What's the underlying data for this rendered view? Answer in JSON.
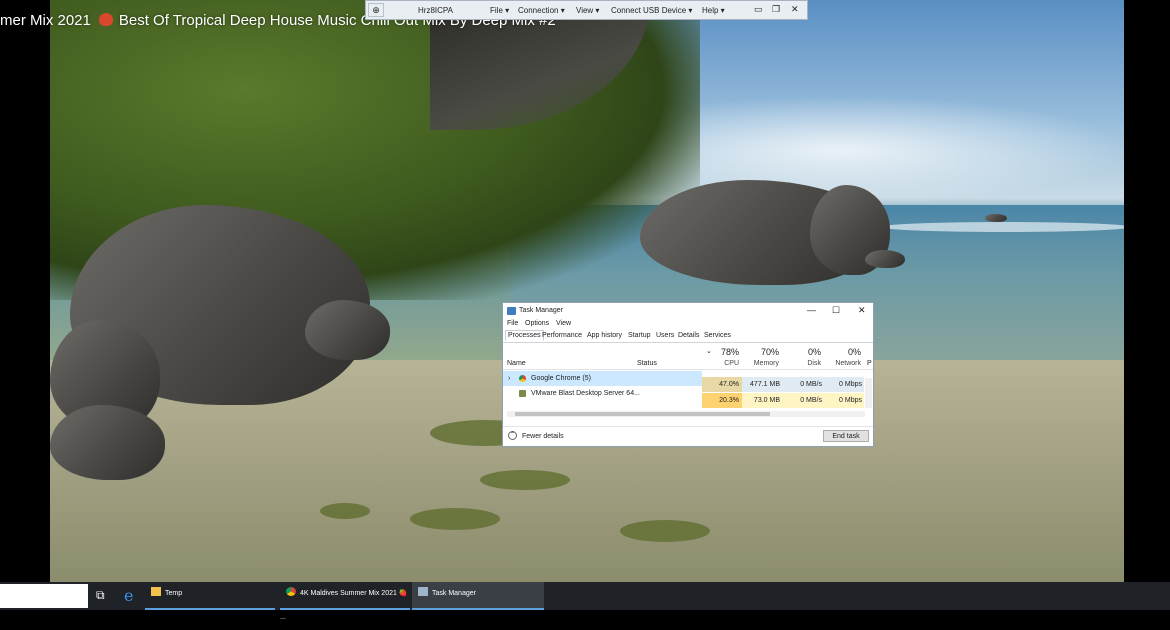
{
  "video": {
    "title": "mer Mix 2021",
    "title_rest": "Best Of Tropical Deep House Music Chill Out Mix By Deep Mix #2",
    "colors": {
      "sky": "#5a8fc4",
      "sea": "#4b86a8",
      "sand": "#b7b496",
      "jungle": "#3e5a1e"
    }
  },
  "vnc_toolbar": {
    "pin_icon": "pin-icon",
    "host": "Hrz8ICPA",
    "menus": [
      "File ▾",
      "Connection ▾",
      "View ▾",
      "Connect USB Device ▾",
      "Help ▾"
    ],
    "controls": [
      "▭",
      "❐",
      "✕"
    ]
  },
  "task_manager": {
    "title": "Task Manager",
    "window_buttons": [
      "—",
      "☐",
      "✕"
    ],
    "menu": [
      "File",
      "Options",
      "View"
    ],
    "tabs": [
      "Processes",
      "Performance",
      "App history",
      "Startup",
      "Users",
      "Details",
      "Services"
    ],
    "active_tab": "Processes",
    "columns": {
      "name": "Name",
      "status": "Status",
      "cpu": {
        "pct": "78%",
        "label": "CPU"
      },
      "memory": {
        "pct": "70%",
        "label": "Memory"
      },
      "disk": {
        "pct": "0%",
        "label": "Disk"
      },
      "network": {
        "pct": "0%",
        "label": "Network"
      },
      "power": "P"
    },
    "rows": [
      {
        "name": "Google Chrome (5)",
        "cpu": "47.0%",
        "memory": "477.1 MB",
        "disk": "0 MB/s",
        "network": "0 Mbps",
        "selected": true
      },
      {
        "name": "VMware Blast Desktop Server 64...",
        "cpu": "20.3%",
        "memory": "73.0 MB",
        "disk": "0 MB/s",
        "network": "0 Mbps",
        "selected": false
      }
    ],
    "fewer_details": "Fewer details",
    "end_task": "End task",
    "colors": {
      "selected_row": "#cce8ff",
      "cpu_high": "#ffd271",
      "memory_fill": "#fff4c4"
    }
  },
  "taskbar": {
    "items": [
      {
        "label": "",
        "icon": "task-view-icon"
      },
      {
        "label": "",
        "icon": "edge-icon"
      },
      {
        "label": "Temp",
        "icon": "folder-icon"
      },
      {
        "label": "4K Maldives Summer Mix 2021 🍓 ...",
        "icon": "chrome-icon"
      },
      {
        "label": "Task Manager",
        "icon": "task-manager-icon"
      }
    ]
  }
}
